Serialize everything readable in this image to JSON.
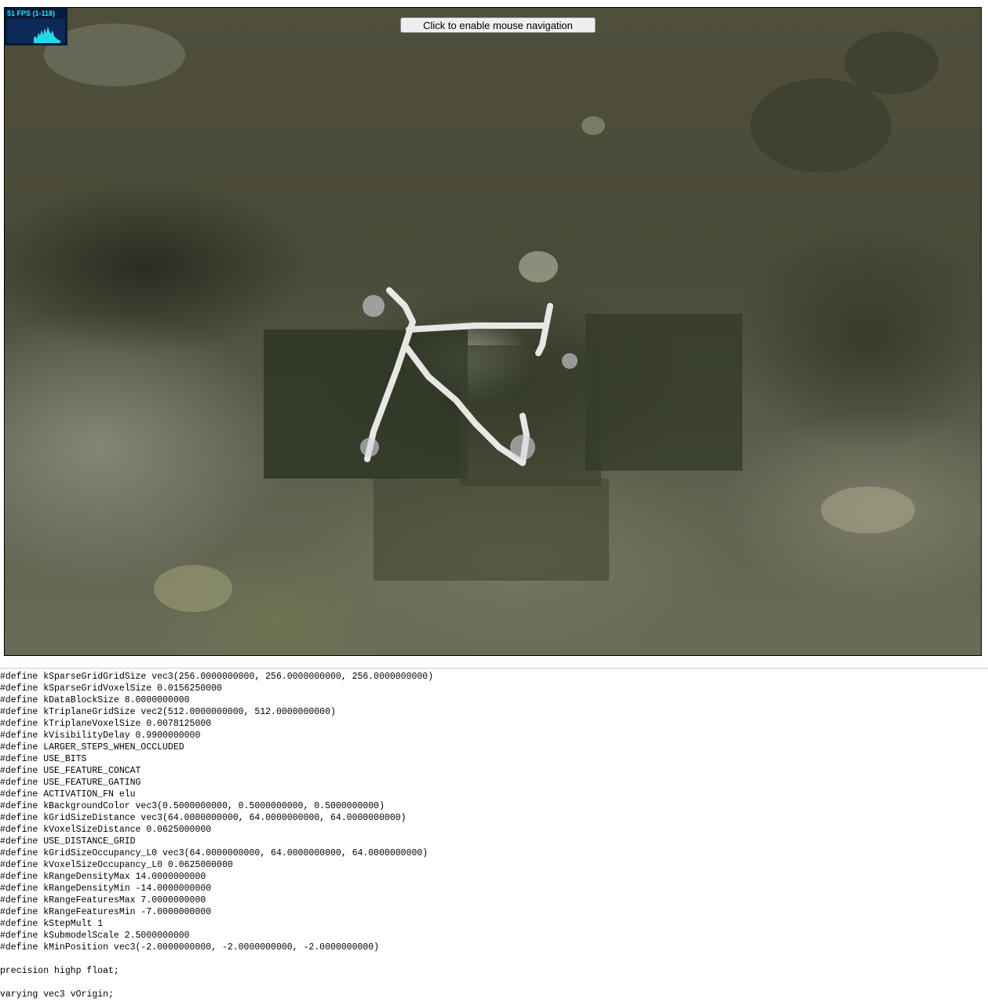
{
  "fps_meter": {
    "label": "51 FPS (1-118)"
  },
  "viewer": {
    "enable_mouse_label": "Click to enable mouse navigation"
  },
  "shader_lines": [
    "#define kSparseGridGridSize vec3(256.0000000000, 256.0000000000, 256.0000000000)",
    "#define kSparseGridVoxelSize 0.0156250000",
    "#define kDataBlockSize 8.0000000000",
    "#define kTriplaneGridSize vec2(512.0000000000, 512.0000000000)",
    "#define kTriplaneVoxelSize 0.0078125000",
    "#define kVisibilityDelay 0.9900000000",
    "#define LARGER_STEPS_WHEN_OCCLUDED",
    "#define USE_BITS",
    "#define USE_FEATURE_CONCAT",
    "#define USE_FEATURE_GATING",
    "#define ACTIVATION_FN elu",
    "#define kBackgroundColor vec3(0.5000000000, 0.5000000000, 0.5000000000)",
    "#define kGridSizeDistance vec3(64.0000000000, 64.0000000000, 64.0000000000)",
    "#define kVoxelSizeDistance 0.0625000000",
    "#define USE_DISTANCE_GRID",
    "#define kGridSizeOccupancy_L0 vec3(64.0000000000, 64.0000000000, 64.0000000000)",
    "#define kVoxelSizeOccupancy_L0 0.0625000000",
    "#define kRangeDensityMax 14.0000000000",
    "#define kRangeDensityMin -14.0000000000",
    "#define kRangeFeaturesMax 7.0000000000",
    "#define kRangeFeaturesMin -7.0000000000",
    "#define kStepMult 1",
    "#define kSubmodelScale 2.5000000000",
    "#define kMinPosition vec3(-2.0000000000, -2.0000000000, -2.0000000000)",
    "",
    "precision highp float;",
    "",
    "varying vec3 vOrigin;"
  ]
}
